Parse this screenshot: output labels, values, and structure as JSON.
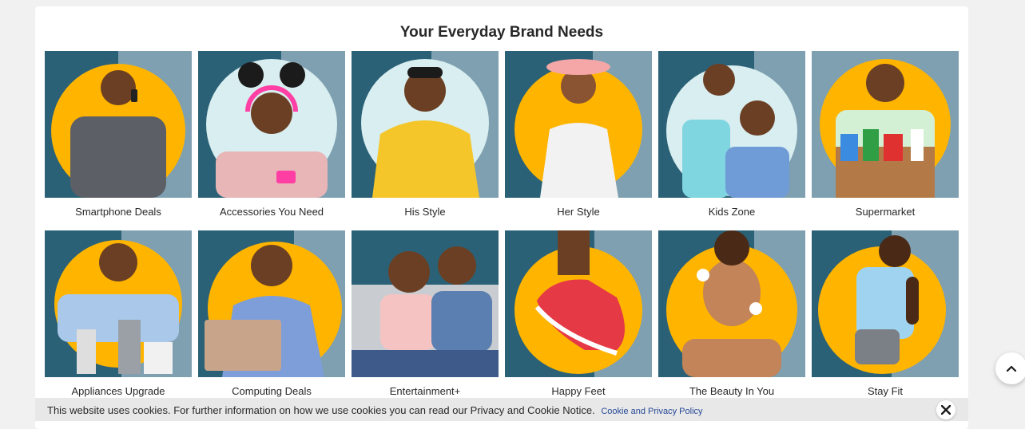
{
  "section": {
    "title": "Your Everyday Brand Needs"
  },
  "categories": [
    {
      "label": "Smartphone Deals",
      "variant": "dark-yellow",
      "icon": "man-on-phone-icon"
    },
    {
      "label": "Accessories You Need",
      "variant": "grey-mint",
      "icon": "woman-with-headphones-icon"
    },
    {
      "label": "His Style",
      "variant": "grey-mint",
      "icon": "man-in-hoodie-icon"
    },
    {
      "label": "Her Style",
      "variant": "dark-yellow",
      "icon": "woman-in-sunhat-icon"
    },
    {
      "label": "Kids Zone",
      "variant": "dark-mint",
      "icon": "children-icon"
    },
    {
      "label": "Supermarket",
      "variant": "grey-yellow",
      "icon": "grocery-box-icon"
    },
    {
      "label": "Appliances Upgrade",
      "variant": "dark-yellow",
      "icon": "kitchen-appliances-icon"
    },
    {
      "label": "Computing Deals",
      "variant": "dark-yellow",
      "icon": "laptop-icon"
    },
    {
      "label": "Entertainment+",
      "variant": "dark-only",
      "icon": "couple-on-sofa-icon"
    },
    {
      "label": "Happy Feet",
      "variant": "dark-yellow",
      "icon": "sneaker-icon"
    },
    {
      "label": "The Beauty In You",
      "variant": "dark-yellow",
      "icon": "beauty-icon"
    },
    {
      "label": "Stay Fit",
      "variant": "dark-yellow",
      "icon": "fitness-icon"
    }
  ],
  "cookie": {
    "text": "This website uses cookies. For further information on how we use cookies you can read our Privacy and Cookie Notice.",
    "link": "Cookie and Privacy Policy"
  },
  "colors": {
    "dark": "#2a6176",
    "grey": "#7fa0b1",
    "yellow": "#ffb400",
    "mint": "#d9eef0"
  }
}
